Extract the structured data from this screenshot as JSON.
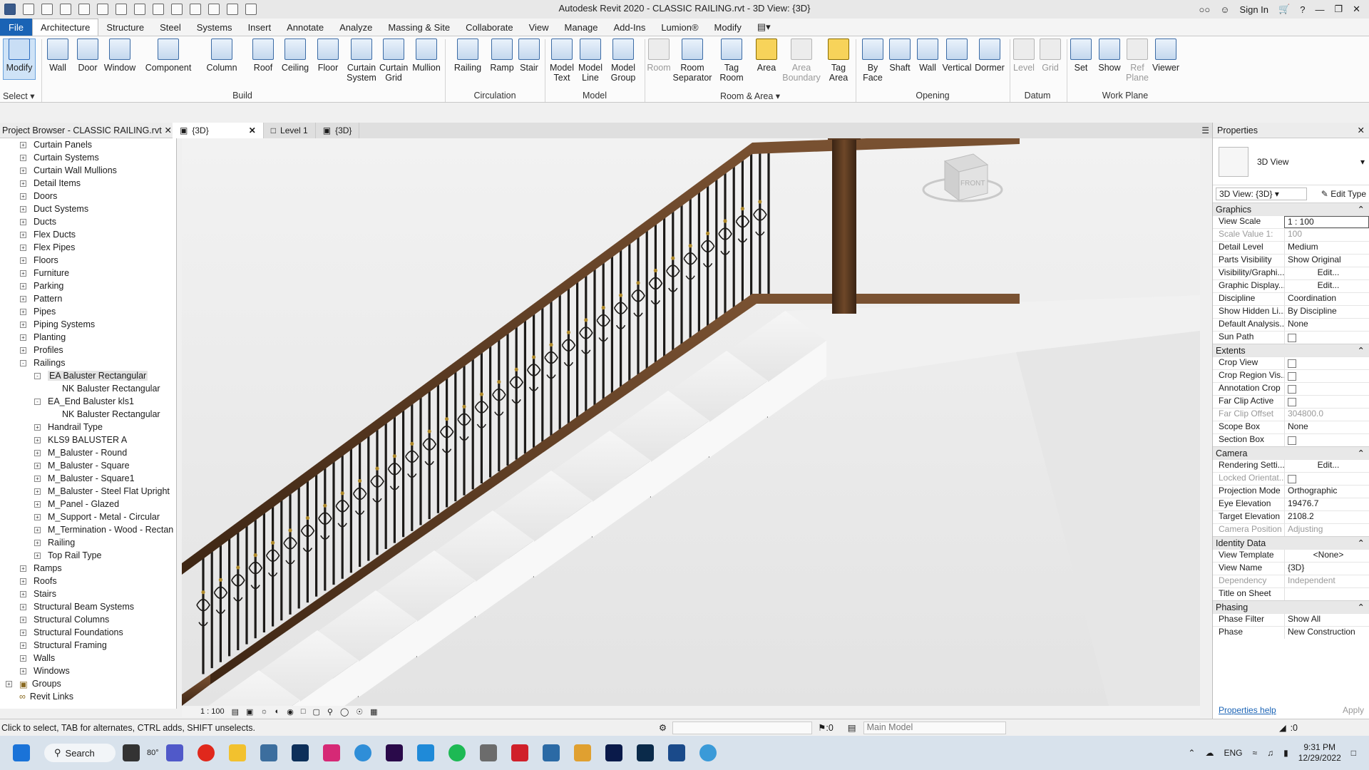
{
  "app": {
    "title": "Autodesk Revit 2020 - CLASSIC RAILING.rvt - 3D View: {3D}",
    "sign_in": "Sign In"
  },
  "menu": {
    "file": "File",
    "tabs": [
      "Architecture",
      "Structure",
      "Steel",
      "Systems",
      "Insert",
      "Annotate",
      "Analyze",
      "Massing & Site",
      "Collaborate",
      "View",
      "Manage",
      "Add-Ins",
      "Lumion®",
      "Modify"
    ]
  },
  "ribbon": {
    "modify": "Modify",
    "select": "Select",
    "build": {
      "label": "Build",
      "items": [
        "Wall",
        "Door",
        "Window",
        "Component",
        "Column",
        "Roof",
        "Ceiling",
        "Floor",
        "Curtain System",
        "Curtain Grid",
        "Mullion"
      ]
    },
    "circulation": {
      "label": "Circulation",
      "items": [
        "Railing",
        "Ramp",
        "Stair"
      ]
    },
    "model": {
      "label": "Model",
      "items": [
        "Model Text",
        "Model Line",
        "Model Group"
      ]
    },
    "room_area": {
      "label": "Room & Area",
      "items": [
        "Room",
        "Room Separator",
        "Tag Room",
        "Area",
        "Area Boundary",
        "Tag Area"
      ]
    },
    "opening": {
      "label": "Opening",
      "items": [
        "By Face",
        "Shaft",
        "Wall",
        "Vertical",
        "Dormer"
      ]
    },
    "datum": {
      "label": "Datum",
      "items": [
        "Level",
        "Grid"
      ]
    },
    "work_plane": {
      "label": "Work Plane",
      "items": [
        "Set",
        "Show",
        "Ref Plane",
        "Viewer"
      ]
    }
  },
  "view_tabs": [
    {
      "label": "{3D}",
      "active": true
    },
    {
      "label": "Level 1",
      "active": false
    },
    {
      "label": "{3D}",
      "active": false
    }
  ],
  "browser": {
    "title": "Project Browser - CLASSIC RAILING.rvt",
    "items": [
      {
        "label": "Curtain Panels",
        "level": 1,
        "exp": "+"
      },
      {
        "label": "Curtain Systems",
        "level": 1,
        "exp": "+"
      },
      {
        "label": "Curtain Wall Mullions",
        "level": 1,
        "exp": "+"
      },
      {
        "label": "Detail Items",
        "level": 1,
        "exp": "+"
      },
      {
        "label": "Doors",
        "level": 1,
        "exp": "+"
      },
      {
        "label": "Duct Systems",
        "level": 1,
        "exp": "+"
      },
      {
        "label": "Ducts",
        "level": 1,
        "exp": "+"
      },
      {
        "label": "Flex Ducts",
        "level": 1,
        "exp": "+"
      },
      {
        "label": "Flex Pipes",
        "level": 1,
        "exp": "+"
      },
      {
        "label": "Floors",
        "level": 1,
        "exp": "+"
      },
      {
        "label": "Furniture",
        "level": 1,
        "exp": "+"
      },
      {
        "label": "Parking",
        "level": 1,
        "exp": "+"
      },
      {
        "label": "Pattern",
        "level": 1,
        "exp": "+"
      },
      {
        "label": "Pipes",
        "level": 1,
        "exp": "+"
      },
      {
        "label": "Piping Systems",
        "level": 1,
        "exp": "+"
      },
      {
        "label": "Planting",
        "level": 1,
        "exp": "+"
      },
      {
        "label": "Profiles",
        "level": 1,
        "exp": "+"
      },
      {
        "label": "Railings",
        "level": 1,
        "exp": "-"
      },
      {
        "label": "EA Baluster Rectangular",
        "level": 2,
        "exp": "-",
        "selected": true
      },
      {
        "label": "NK Baluster Rectangular",
        "level": 3,
        "exp": ""
      },
      {
        "label": "EA_End Baluster kls1",
        "level": 2,
        "exp": "-"
      },
      {
        "label": "NK Baluster Rectangular",
        "level": 3,
        "exp": ""
      },
      {
        "label": "Handrail Type",
        "level": 2,
        "exp": "+"
      },
      {
        "label": "KLS9 BALUSTER A",
        "level": 2,
        "exp": "+"
      },
      {
        "label": "M_Baluster - Round",
        "level": 2,
        "exp": "+"
      },
      {
        "label": "M_Baluster - Square",
        "level": 2,
        "exp": "+"
      },
      {
        "label": "M_Baluster - Square1",
        "level": 2,
        "exp": "+"
      },
      {
        "label": "M_Baluster - Steel Flat Upright",
        "level": 2,
        "exp": "+"
      },
      {
        "label": "M_Panel - Glazed",
        "level": 2,
        "exp": "+"
      },
      {
        "label": "M_Support - Metal - Circular",
        "level": 2,
        "exp": "+"
      },
      {
        "label": "M_Termination - Wood - Rectan",
        "level": 2,
        "exp": "+"
      },
      {
        "label": "Railing",
        "level": 2,
        "exp": "+"
      },
      {
        "label": "Top Rail Type",
        "level": 2,
        "exp": "+"
      },
      {
        "label": "Ramps",
        "level": 1,
        "exp": "+"
      },
      {
        "label": "Roofs",
        "level": 1,
        "exp": "+"
      },
      {
        "label": "Stairs",
        "level": 1,
        "exp": "+"
      },
      {
        "label": "Structural Beam Systems",
        "level": 1,
        "exp": "+"
      },
      {
        "label": "Structural Columns",
        "level": 1,
        "exp": "+"
      },
      {
        "label": "Structural Foundations",
        "level": 1,
        "exp": "+"
      },
      {
        "label": "Structural Framing",
        "level": 1,
        "exp": "+"
      },
      {
        "label": "Walls",
        "level": 1,
        "exp": "+"
      },
      {
        "label": "Windows",
        "level": 1,
        "exp": "+"
      },
      {
        "label": "Groups",
        "level": 0,
        "exp": "+"
      },
      {
        "label": "Revit Links",
        "level": 0,
        "exp": ""
      }
    ]
  },
  "viewport": {
    "scale": "1 : 100",
    "viewcube": "FRONT"
  },
  "properties": {
    "title": "Properties",
    "type": "3D View",
    "view_selector": "3D View: {3D}",
    "edit_type": "Edit Type",
    "sections": [
      {
        "name": "Graphics",
        "rows": [
          {
            "k": "View Scale",
            "v": "1 : 100"
          },
          {
            "k": "Scale Value    1:",
            "v": "100",
            "ro": true
          },
          {
            "k": "Detail Level",
            "v": "Medium"
          },
          {
            "k": "Parts Visibility",
            "v": "Show Original"
          },
          {
            "k": "Visibility/Graphi...",
            "v": "Edit...",
            "btn": true
          },
          {
            "k": "Graphic Display...",
            "v": "Edit...",
            "btn": true
          },
          {
            "k": "Discipline",
            "v": "Coordination"
          },
          {
            "k": "Show Hidden Li...",
            "v": "By Discipline"
          },
          {
            "k": "Default Analysis...",
            "v": "None"
          },
          {
            "k": "Sun Path",
            "v": "",
            "cb": true
          }
        ]
      },
      {
        "name": "Extents",
        "rows": [
          {
            "k": "Crop View",
            "v": "",
            "cb": true
          },
          {
            "k": "Crop Region Vis...",
            "v": "",
            "cb": true
          },
          {
            "k": "Annotation Crop",
            "v": "",
            "cb": true
          },
          {
            "k": "Far Clip Active",
            "v": "",
            "cb": true
          },
          {
            "k": "Far Clip Offset",
            "v": "304800.0",
            "ro": true
          },
          {
            "k": "Scope Box",
            "v": "None"
          },
          {
            "k": "Section Box",
            "v": "",
            "cb": true
          }
        ]
      },
      {
        "name": "Camera",
        "rows": [
          {
            "k": "Rendering Setti...",
            "v": "Edit...",
            "btn": true
          },
          {
            "k": "Locked Orientat...",
            "v": "",
            "cb": true,
            "ro": true
          },
          {
            "k": "Projection Mode",
            "v": "Orthographic"
          },
          {
            "k": "Eye Elevation",
            "v": "19476.7"
          },
          {
            "k": "Target Elevation",
            "v": "2108.2"
          },
          {
            "k": "Camera Position",
            "v": "Adjusting",
            "ro": true
          }
        ]
      },
      {
        "name": "Identity Data",
        "rows": [
          {
            "k": "View Template",
            "v": "<None>",
            "btn": true
          },
          {
            "k": "View Name",
            "v": "{3D}"
          },
          {
            "k": "Dependency",
            "v": "Independent",
            "ro": true
          },
          {
            "k": "Title on Sheet",
            "v": ""
          }
        ]
      },
      {
        "name": "Phasing",
        "rows": [
          {
            "k": "Phase Filter",
            "v": "Show All"
          },
          {
            "k": "Phase",
            "v": "New Construction"
          }
        ]
      }
    ],
    "help": "Properties help",
    "apply": "Apply"
  },
  "status": {
    "hint": "Click to select, TAB for alternates, CTRL adds, SHIFT unselects.",
    "count": ":0",
    "model": "Main Model",
    "filter": ":0"
  },
  "taskbar": {
    "search": "Search",
    "weather": "80°",
    "lang": "ENG",
    "time": "9:31 PM",
    "date": "12/29/2022"
  },
  "colors": {
    "accent": "#1a63b5",
    "wood": "#5a3a22",
    "iron": "#1c1a18"
  }
}
